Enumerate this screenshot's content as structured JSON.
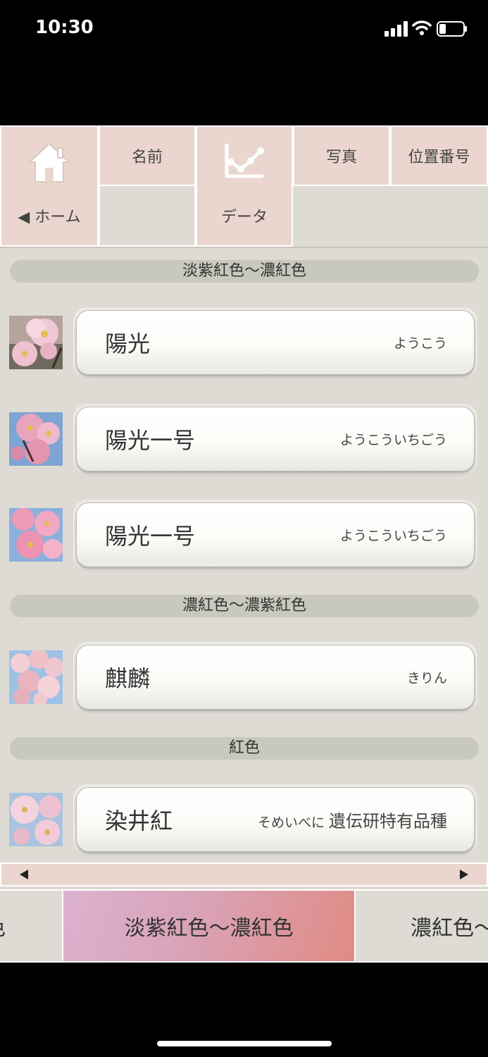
{
  "status_bar": {
    "time": "10:30"
  },
  "tabs": {
    "home": "◀ ホーム",
    "name": "名前",
    "data": "データ",
    "photo": "写真",
    "position": "位置番号"
  },
  "sections": [
    {
      "title": "淡紫紅色〜濃紅色",
      "items": [
        {
          "name": "陽光",
          "reading": "ようこう",
          "note": ""
        },
        {
          "name": "陽光一号",
          "reading": "ようこういちごう",
          "note": ""
        },
        {
          "name": "陽光一号",
          "reading": "ようこういちごう",
          "note": ""
        }
      ]
    },
    {
      "title": "濃紅色〜濃紫紅色",
      "items": [
        {
          "name": "麒麟",
          "reading": "きりん",
          "note": ""
        }
      ]
    },
    {
      "title": "紅色",
      "items": [
        {
          "name": "染井紅",
          "reading": "そめいべに",
          "note": "遺伝研特有品種"
        }
      ]
    }
  ],
  "categories": {
    "prev_partial": "色",
    "active": "淡紫紅色〜濃紅色",
    "next_partial": "濃紅色〜"
  },
  "colors": {
    "tab_bg": "#ead6cf",
    "app_bg": "#dddbd3",
    "section_header_bg": "#c9c8bd",
    "active_gradient_start": "#dcb2d0",
    "active_gradient_end": "#e08a83"
  },
  "icons": {
    "home": "house-icon",
    "data": "line-chart-icon",
    "scroll_left": "triangle-left-icon",
    "scroll_right": "triangle-right-icon"
  }
}
